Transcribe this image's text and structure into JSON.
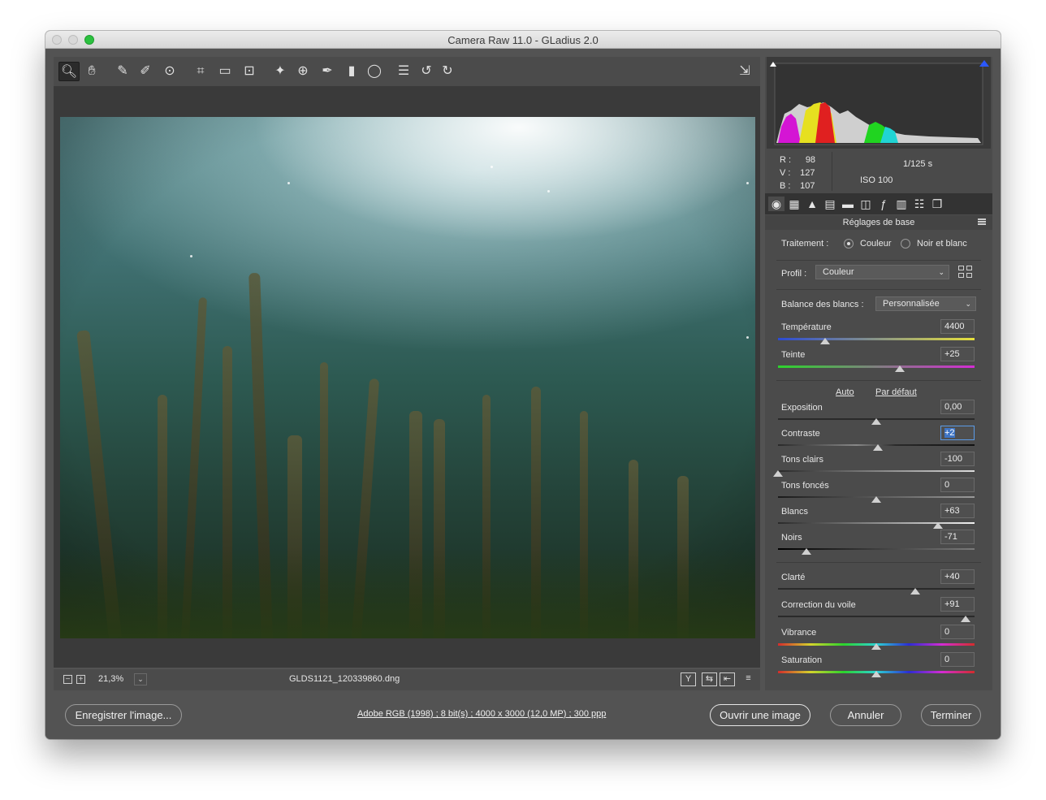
{
  "window": {
    "title": "Camera Raw 11.0  -  GLadius 2.0"
  },
  "toolbar": {
    "tools": [
      "zoom-tool",
      "hand-tool",
      "white-balance-tool",
      "color-sampler-tool",
      "targeted-adjustment-tool",
      "crop-tool",
      "straighten-tool",
      "transform-tool",
      "spot-removal-tool",
      "red-eye-tool",
      "adjustment-brush",
      "graduated-filter",
      "radial-filter",
      "presets-list",
      "rotate-left",
      "rotate-right"
    ],
    "export_icon": "open-preferences-icon"
  },
  "preview": {
    "zoom_value": "21,3%",
    "filename": "GLDS1121_120339860.dng",
    "view_buttons": [
      "Y",
      "⇆",
      "⇤",
      "≡"
    ]
  },
  "histogram": {
    "readout": {
      "r_label": "R :",
      "r": "98",
      "v_label": "V :",
      "v": "127",
      "b_label": "B :",
      "b": "107"
    },
    "shutter": "1/125 s",
    "iso": "ISO 100"
  },
  "panel": {
    "section_title": "Réglages de base",
    "traitement_label": "Traitement :",
    "couleur_label": "Couleur",
    "nb_label": "Noir et blanc",
    "profil_label": "Profil :",
    "profil_value": "Couleur",
    "wb_label": "Balance des blancs :",
    "wb_value": "Personnalisée",
    "auto_label": "Auto",
    "default_label": "Par défaut",
    "sliders": {
      "temperature": {
        "label": "Température",
        "value": "4400",
        "pos": 0.24
      },
      "teinte": {
        "label": "Teinte",
        "value": "+25",
        "pos": 0.62
      },
      "exposition": {
        "label": "Exposition",
        "value": "0,00",
        "pos": 0.5
      },
      "contraste": {
        "label": "Contraste",
        "value": "+2",
        "pos": 0.51
      },
      "tons_clairs": {
        "label": "Tons clairs",
        "value": "-100",
        "pos": 0.0
      },
      "tons_fonces": {
        "label": "Tons foncés",
        "value": "0",
        "pos": 0.5
      },
      "blancs": {
        "label": "Blancs",
        "value": "+63",
        "pos": 0.815
      },
      "noirs": {
        "label": "Noirs",
        "value": "-71",
        "pos": 0.145
      },
      "clarte": {
        "label": "Clarté",
        "value": "+40",
        "pos": 0.7
      },
      "voile": {
        "label": "Correction du voile",
        "value": "+91",
        "pos": 0.955
      },
      "vibrance": {
        "label": "Vibrance",
        "value": "0",
        "pos": 0.5
      },
      "saturation": {
        "label": "Saturation",
        "value": "0",
        "pos": 0.5
      }
    }
  },
  "footer": {
    "save_label": "Enregistrer l'image...",
    "info_link": "Adobe RGB (1998) ; 8 bit(s) ; 4000 x 3000 (12,0 MP) ; 300 ppp",
    "open_label": "Ouvrir une image",
    "cancel_label": "Annuler",
    "done_label": "Terminer"
  },
  "colors": {
    "accent": "#3f75c4",
    "panel_bg": "#4b4b4b",
    "window_bg": "#535353"
  }
}
